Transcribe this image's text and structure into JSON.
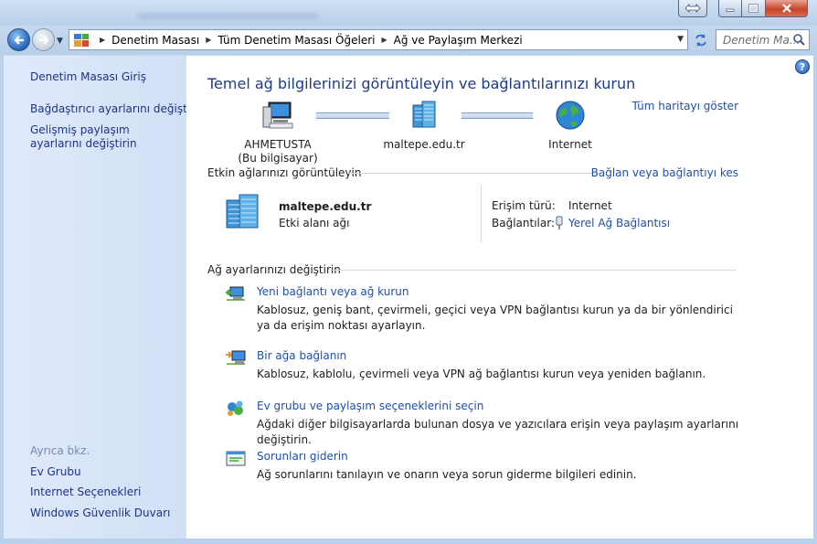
{
  "window": {
    "controls": {
      "minimize": "minimize",
      "maximize": "maximize",
      "close": "close"
    }
  },
  "address": {
    "crumbs": [
      "Denetim Masası",
      "Tüm Denetim Masası Öğeleri",
      "Ağ ve Paylaşım Merkezi"
    ],
    "search_placeholder": "Denetim Ma..."
  },
  "sidebar": {
    "items": [
      "Denetim Masası Giriş",
      "Bağdaştırıcı ayarlarını değiştirin",
      "Gelişmiş paylaşım ayarlarını değiştirin"
    ],
    "see_also_label": "Ayrıca bkz.",
    "see_also": [
      "Ev Grubu",
      "Internet Seçenekleri",
      "Windows Güvenlik Duvarı"
    ]
  },
  "main": {
    "title": "Temel ağ bilgilerinizi görüntüleyin ve bağlantılarınızı kurun",
    "show_full_map": "Tüm haritayı göster",
    "map": {
      "computer_name": "AHMETUSTA",
      "computer_sub": "(Bu bilgisayar)",
      "domain": "maltepe.edu.tr",
      "internet": "Internet"
    },
    "active_section": {
      "heading": "Etkin ağlarınızı görüntüleyin",
      "connect_link": "Bağlan veya bağlantıyı kes",
      "network_name": "maltepe.edu.tr",
      "network_type": "Etki alanı ağı",
      "access_label": "Erişim türü:",
      "access_value": "Internet",
      "connections_label": "Bağlantılar:",
      "connections_value": "Yerel Ağ Bağlantısı"
    },
    "settings_section": {
      "heading": "Ağ ayarlarınızı değiştirin",
      "tasks": [
        {
          "title": "Yeni bağlantı veya ağ kurun",
          "desc": "Kablosuz, geniş bant, çevirmeli, geçici veya VPN bağlantısı kurun ya da bir yönlendirici ya da erişim noktası ayarlayın."
        },
        {
          "title": "Bir ağa bağlanın",
          "desc": "Kablosuz, kablolu, çevirmeli veya VPN ağ bağlantısı kurun veya yeniden bağlanın."
        },
        {
          "title": "Ev grubu ve paylaşım seçeneklerini seçin",
          "desc": "Ağdaki diğer bilgisayarlarda bulunan dosya ve yazıcılara erişin veya paylaşım ayarlarını değiştirin."
        },
        {
          "title": "Sorunları giderin",
          "desc": "Ağ sorunlarını tanılayın ve onarın veya sorun giderme bilgileri edinin."
        }
      ]
    }
  },
  "colors": {
    "link": "#1e4fae",
    "title": "#1e3a8a",
    "sidebar_link": "#1e3287"
  }
}
